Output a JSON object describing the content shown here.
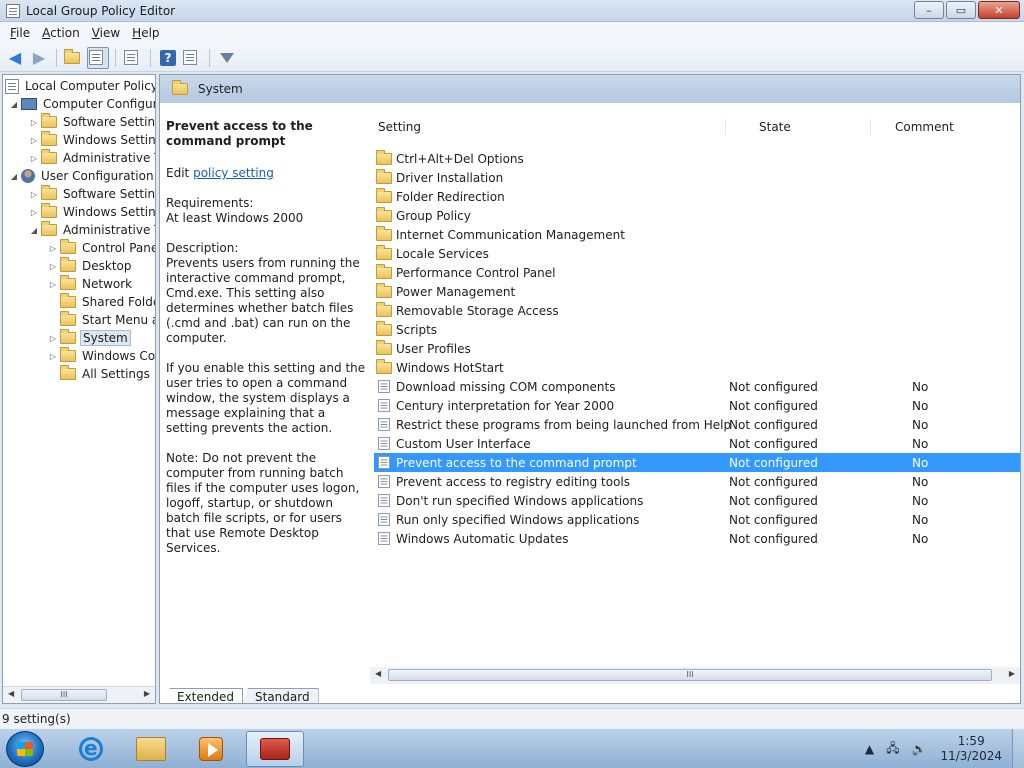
{
  "window": {
    "title": "Local Group Policy Editor",
    "min": "–",
    "max": "▭",
    "close": "✕"
  },
  "menu": [
    {
      "key": "F",
      "rest": "ile"
    },
    {
      "key": "A",
      "rest": "ction"
    },
    {
      "key": "V",
      "rest": "iew"
    },
    {
      "key": "H",
      "rest": "elp"
    }
  ],
  "toolbar": {
    "back": "◀",
    "forward": "▶",
    "help": "?"
  },
  "tree": {
    "items": [
      {
        "label": "Local Computer Policy",
        "icon": "policy-doc"
      },
      {
        "label": "Computer Configura",
        "icon": "computer"
      },
      {
        "label": "Software Settings",
        "icon": "folder"
      },
      {
        "label": "Windows Setting",
        "icon": "folder"
      },
      {
        "label": "Administrative Te",
        "icon": "folder"
      },
      {
        "label": "User Configuration",
        "icon": "user"
      },
      {
        "label": "Software Settings",
        "icon": "folder"
      },
      {
        "label": "Windows Setting",
        "icon": "folder"
      },
      {
        "label": "Administrative Te",
        "icon": "folder"
      },
      {
        "label": "Control Panel",
        "icon": "folder"
      },
      {
        "label": "Desktop",
        "icon": "folder"
      },
      {
        "label": "Network",
        "icon": "folder"
      },
      {
        "label": "Shared Folder",
        "icon": "folder"
      },
      {
        "label": "Start Menu ar",
        "icon": "folder"
      },
      {
        "label": "System",
        "icon": "folder"
      },
      {
        "label": "Windows Cor",
        "icon": "folder"
      },
      {
        "label": "All Settings",
        "icon": "folder"
      }
    ]
  },
  "main": {
    "header": "System",
    "description": {
      "title": "Prevent access to the command prompt",
      "edit_prefix": "Edit",
      "edit_link": "policy setting",
      "requirements_label": "Requirements:",
      "requirements_value": "At least Windows 2000",
      "description_label": "Description:",
      "p1": "Prevents users from running the interactive command prompt, Cmd.exe. This setting also determines whether batch files (.cmd and .bat) can run on the computer.",
      "p2": "If you enable this setting and the user tries to open a command window, the system displays a message explaining that a setting prevents the action.",
      "p3": "Note: Do not prevent the computer from running batch files if the computer uses logon, logoff, startup, or shutdown batch file scripts, or for users that use Remote Desktop Services."
    },
    "columns": {
      "setting": "Setting",
      "state": "State",
      "comment": "Comment"
    },
    "rows": [
      {
        "name": "Ctrl+Alt+Del Options",
        "state": "",
        "comment": ""
      },
      {
        "name": "Driver Installation",
        "state": "",
        "comment": ""
      },
      {
        "name": "Folder Redirection",
        "state": "",
        "comment": ""
      },
      {
        "name": "Group Policy",
        "state": "",
        "comment": ""
      },
      {
        "name": "Internet Communication Management",
        "state": "",
        "comment": ""
      },
      {
        "name": "Locale Services",
        "state": "",
        "comment": ""
      },
      {
        "name": "Performance Control Panel",
        "state": "",
        "comment": ""
      },
      {
        "name": "Power Management",
        "state": "",
        "comment": ""
      },
      {
        "name": "Removable Storage Access",
        "state": "",
        "comment": ""
      },
      {
        "name": "Scripts",
        "state": "",
        "comment": ""
      },
      {
        "name": "User Profiles",
        "state": "",
        "comment": ""
      },
      {
        "name": "Windows HotStart",
        "state": "",
        "comment": ""
      },
      {
        "name": "Download missing COM components",
        "state": "Not configured",
        "comment": "No"
      },
      {
        "name": "Century interpretation for Year 2000",
        "state": "Not configured",
        "comment": "No"
      },
      {
        "name": "Restrict these programs from being launched from Help",
        "state": "Not configured",
        "comment": "No"
      },
      {
        "name": "Custom User Interface",
        "state": "Not configured",
        "comment": "No"
      },
      {
        "name": "Prevent access to the command prompt",
        "state": "Not configured",
        "comment": "No"
      },
      {
        "name": "Prevent access to registry editing tools",
        "state": "Not configured",
        "comment": "No"
      },
      {
        "name": "Don't run specified Windows applications",
        "state": "Not configured",
        "comment": "No"
      },
      {
        "name": "Run only specified Windows applications",
        "state": "Not configured",
        "comment": "No"
      },
      {
        "name": "Windows Automatic Updates",
        "state": "Not configured",
        "comment": "No"
      }
    ],
    "tabs": {
      "extended": "Extended",
      "standard": "Standard"
    }
  },
  "status": {
    "text": "9 setting(s)"
  },
  "taskbar": {
    "clock_time": "1:59",
    "clock_date": "11/3/2024",
    "tray_arrow": "▲",
    "volume": "🔊"
  },
  "scroll": {
    "grip": "III",
    "left": "◀",
    "right": "▶"
  }
}
